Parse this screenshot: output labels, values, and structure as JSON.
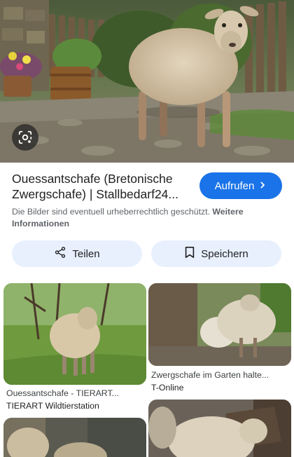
{
  "result": {
    "title": "Ouessantschafe (Bretonische Zwergschafe) | Stallbedarf24...",
    "visit_label": "Aufrufen",
    "copyright_text": "Die Bilder sind eventuell urheberrechtlich geschützt.",
    "more_info_label": "Weitere Informationen"
  },
  "actions": {
    "share_label": "Teilen",
    "save_label": "Speichern"
  },
  "related": [
    {
      "caption": "Ouessantschafe - TIERART...",
      "source": "TIERART Wildtierstation"
    },
    {
      "caption": "Zwergschafe im Garten halte...",
      "source": "T-Online"
    },
    {
      "caption": "",
      "source": ""
    },
    {
      "caption": "",
      "source": ""
    }
  ],
  "icons": {
    "lens": "google-lens-icon",
    "visit": "chevron-right-icon",
    "share": "share-icon",
    "save": "bookmark-icon"
  }
}
